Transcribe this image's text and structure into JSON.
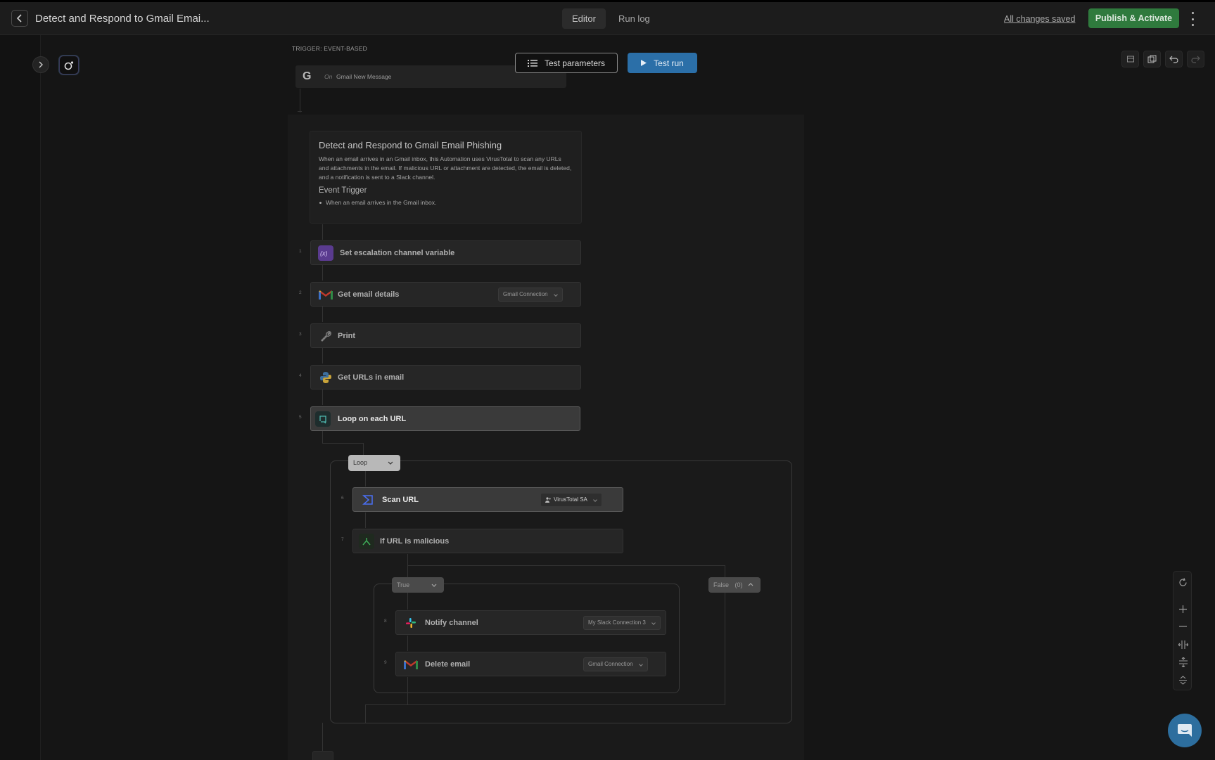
{
  "header": {
    "title": "Detect and Respond to Gmail Emai...",
    "tabs": [
      {
        "label": "Editor",
        "active": true
      },
      {
        "label": "Run log",
        "active": false
      }
    ],
    "saved_status": "All changes saved",
    "publish_label": "Publish & Activate"
  },
  "canvas_toolbar": {
    "test_parameters_label": "Test parameters",
    "test_run_label": "Test run"
  },
  "trigger": {
    "section_label": "TRIGGER: EVENT-BASED",
    "on_label": "On",
    "event_name": "Gmail New Message",
    "icon_letter": "G"
  },
  "description": {
    "title": "Detect and Respond to Gmail Email Phishing",
    "body": "When an email arrives in an Gmail inbox, this Automation uses VirusTotal to scan any URLs and attachments in the email. If malicious URL or attachment are detected, the email is deleted, and a notification is sent to a Slack channel.",
    "subheading": "Event Trigger",
    "bullets": [
      "When an email arrives in the Gmail inbox."
    ]
  },
  "steps": [
    {
      "num": "1",
      "label": "Set escalation channel variable",
      "icon": "variable-icon"
    },
    {
      "num": "2",
      "label": "Get email details",
      "icon": "gmail-icon",
      "connection": "Gmail Connection"
    },
    {
      "num": "3",
      "label": "Print",
      "icon": "wrench-icon"
    },
    {
      "num": "4",
      "label": "Get URLs in email",
      "icon": "python-icon"
    },
    {
      "num": "5",
      "label": "Loop on each URL",
      "icon": "loop-icon",
      "active": true
    },
    {
      "num": "6",
      "label": "Scan URL",
      "icon": "virustotal-icon",
      "connection": "VirusTotal SA"
    },
    {
      "num": "7",
      "label": "If URL is malicious",
      "icon": "branch-icon"
    },
    {
      "num": "8",
      "label": "Notify channel",
      "icon": "slack-icon",
      "connection": "My Slack Connection 3"
    },
    {
      "num": "9",
      "label": "Delete email",
      "icon": "gmail-icon",
      "connection": "Gmail Connection"
    }
  ],
  "loop_tag": "Loop",
  "branches": {
    "true_label": "True",
    "false_label": "False",
    "false_count": "(0)"
  },
  "colors": {
    "publish": "#2f7a3d",
    "test_run": "#2b6fa8",
    "chat": "#2d6e9e"
  }
}
